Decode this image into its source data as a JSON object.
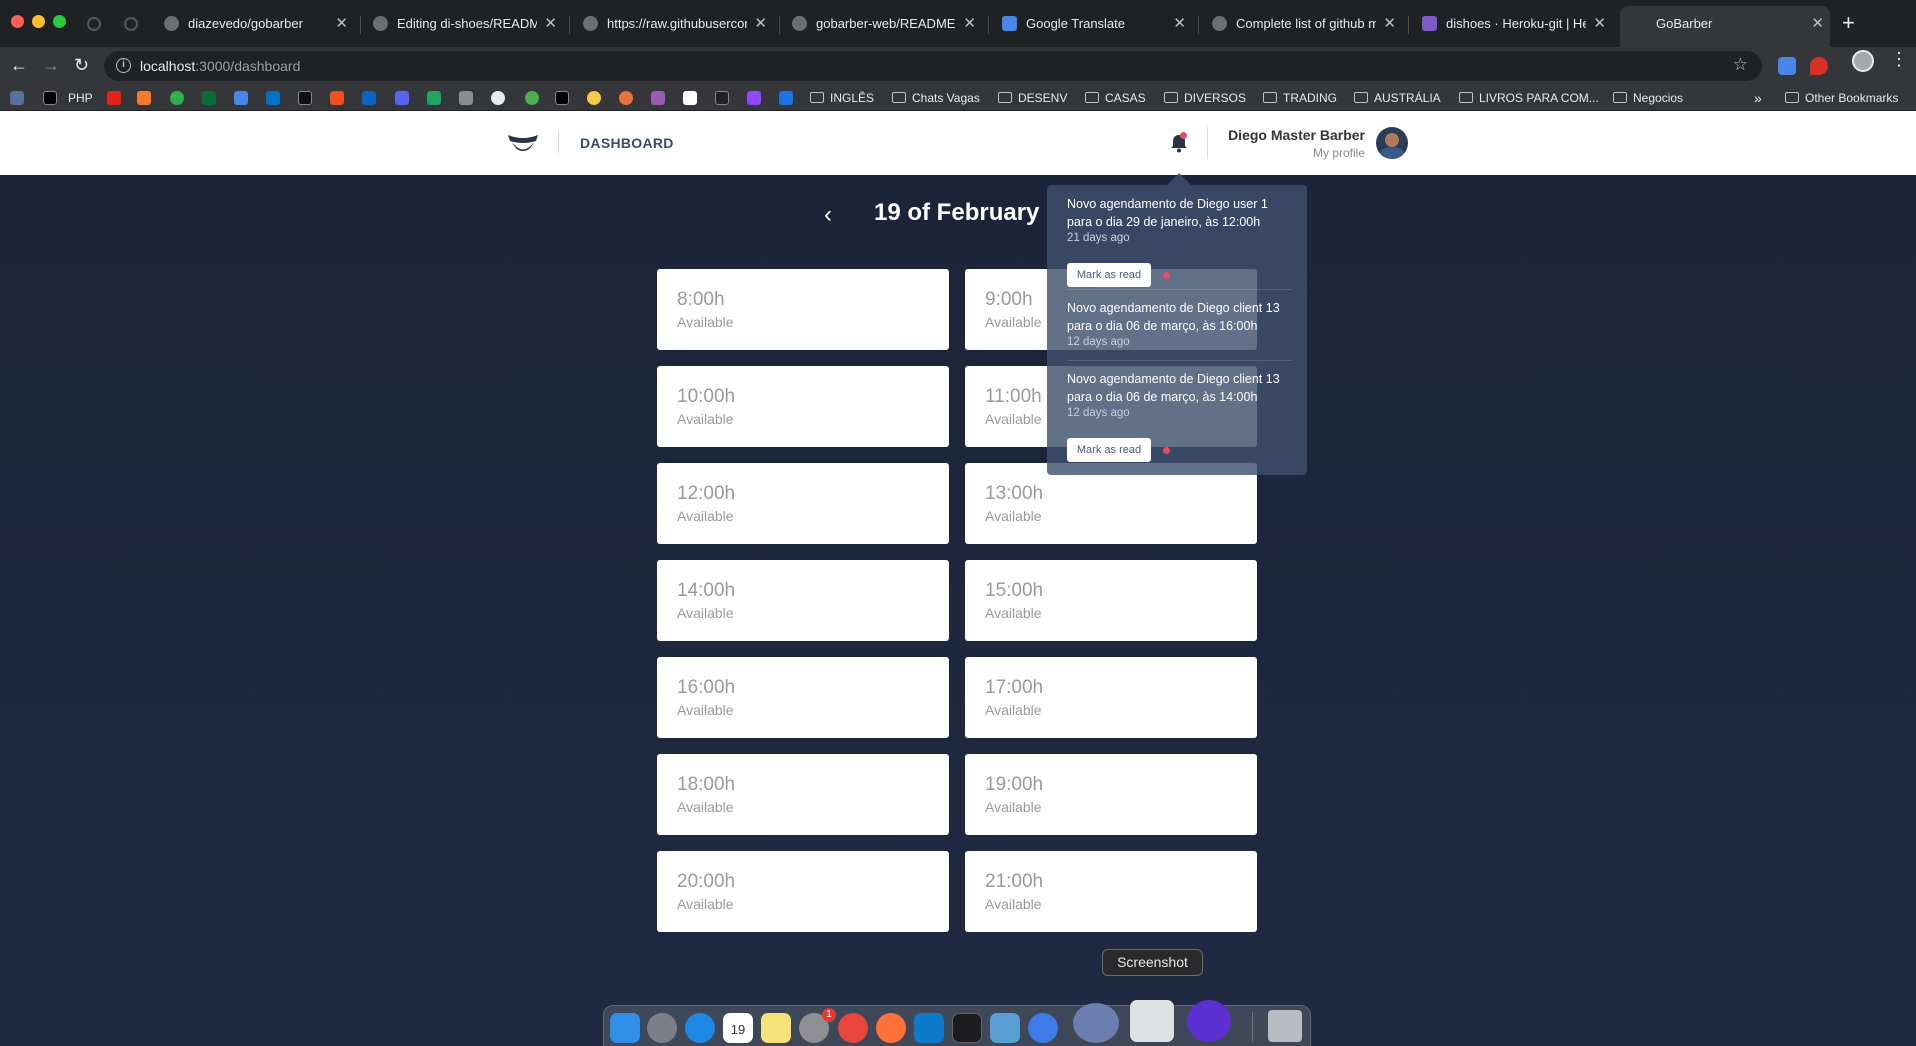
{
  "browser": {
    "tabs": [
      {
        "label": "diazevedo/gobarber"
      },
      {
        "label": "Editing di-shoes/README.md"
      },
      {
        "label": "https://raw.githubusercontent.com"
      },
      {
        "label": "gobarber-web/README.md"
      },
      {
        "label": "Google Translate"
      },
      {
        "label": "Complete list of github markdown"
      },
      {
        "label": "dishoes · Heroku-git | Heroku"
      },
      {
        "label": "GoBarber"
      }
    ],
    "close_glyph": "✕",
    "new_tab_glyph": "+",
    "url_host": "localhost",
    "url_rest": ":3000/dashboard",
    "bookmarks": [
      {
        "label": "PHP"
      },
      {
        "label": "INGLÊS"
      },
      {
        "label": "Chats Vagas"
      },
      {
        "label": "DESENV"
      },
      {
        "label": "CASAS"
      },
      {
        "label": "DIVERSOS"
      },
      {
        "label": "TRADING"
      },
      {
        "label": "AUSTRÁLIA"
      },
      {
        "label": "LIVROS PARA COM..."
      },
      {
        "label": "Negocios"
      },
      {
        "label": "Other Bookmarks"
      }
    ],
    "overflow_glyph": "»"
  },
  "header": {
    "title": "DASHBOARD",
    "user_name": "Diego Master Barber",
    "profile_link": "My profile"
  },
  "schedule": {
    "prev_glyph": "‹",
    "date_title": "19 of February",
    "slots": [
      {
        "time": "8:00h",
        "status": "Available"
      },
      {
        "time": "9:00h",
        "status": "Available"
      },
      {
        "time": "10:00h",
        "status": "Available"
      },
      {
        "time": "11:00h",
        "status": "Available"
      },
      {
        "time": "12:00h",
        "status": "Available"
      },
      {
        "time": "13:00h",
        "status": "Available"
      },
      {
        "time": "14:00h",
        "status": "Available"
      },
      {
        "time": "15:00h",
        "status": "Available"
      },
      {
        "time": "16:00h",
        "status": "Available"
      },
      {
        "time": "17:00h",
        "status": "Available"
      },
      {
        "time": "18:00h",
        "status": "Available"
      },
      {
        "time": "19:00h",
        "status": "Available"
      },
      {
        "time": "20:00h",
        "status": "Available"
      },
      {
        "time": "21:00h",
        "status": "Available"
      }
    ]
  },
  "notifications": [
    {
      "message": "Novo agendamento de Diego user 1 para o dia 29 de janeiro, às 12:00h",
      "time_ago": "21 days ago",
      "action": "Mark as read",
      "unread": true
    },
    {
      "message": "Novo agendamento de Diego client 13 para o dia 06 de março, às 16:00h",
      "time_ago": "12 days ago",
      "unread": false
    },
    {
      "message": "Novo agendamento de Diego client 13 para o dia 06 de março, às 14:00h",
      "time_ago": "12 days ago",
      "action": "Mark as read",
      "unread": true
    }
  ],
  "dock": {
    "tooltip": "Screenshot",
    "calendar_day": "19",
    "badge": "1"
  },
  "colors": {
    "background": "#1b2438",
    "unread_dot": "#e84a6a",
    "slot_bg": "#ffffff"
  }
}
